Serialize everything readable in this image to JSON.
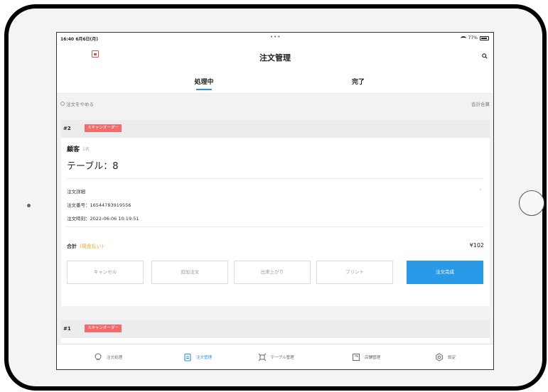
{
  "status_bar": {
    "time": "16:40 6月6日(月)",
    "dots": "•••",
    "battery": "77%"
  },
  "nav": {
    "title": "注文管理"
  },
  "tabs": [
    {
      "label": "処理中",
      "active": true
    },
    {
      "label": "完了",
      "active": false
    }
  ],
  "toolbar": {
    "cancel_label": "注文をやめる",
    "merge_label": "会計合算"
  },
  "orders": [
    {
      "number": "#2",
      "badge": "スキャンオーダー",
      "customer_label": "顧客",
      "customer_count": "1名",
      "table": "テーブル：8",
      "detail_label": "注文詳細",
      "order_no": "注文番号：16544783919556",
      "order_time": "注文時刻：2022-06-06 10:19:51",
      "total_label": "合計",
      "payment": "(現金払い)",
      "total_amount": "¥102",
      "buttons": [
        "キャンセル",
        "追加注文",
        "出来上がり",
        "プリント",
        "注文完成"
      ]
    },
    {
      "number": "#1",
      "badge": "スキャンオーダー"
    }
  ],
  "bottom_nav": [
    {
      "label": "注文処理",
      "icon": "chat-icon"
    },
    {
      "label": "注文管理",
      "icon": "clipboard-icon"
    },
    {
      "label": "テーブル管理",
      "icon": "table-icon"
    },
    {
      "label": "店舗管理",
      "icon": "store-icon"
    },
    {
      "label": "設定",
      "icon": "gear-icon"
    }
  ],
  "colors": {
    "accent": "#2a8ee6",
    "badge": "#f26a6a",
    "payment": "#f0a030"
  }
}
